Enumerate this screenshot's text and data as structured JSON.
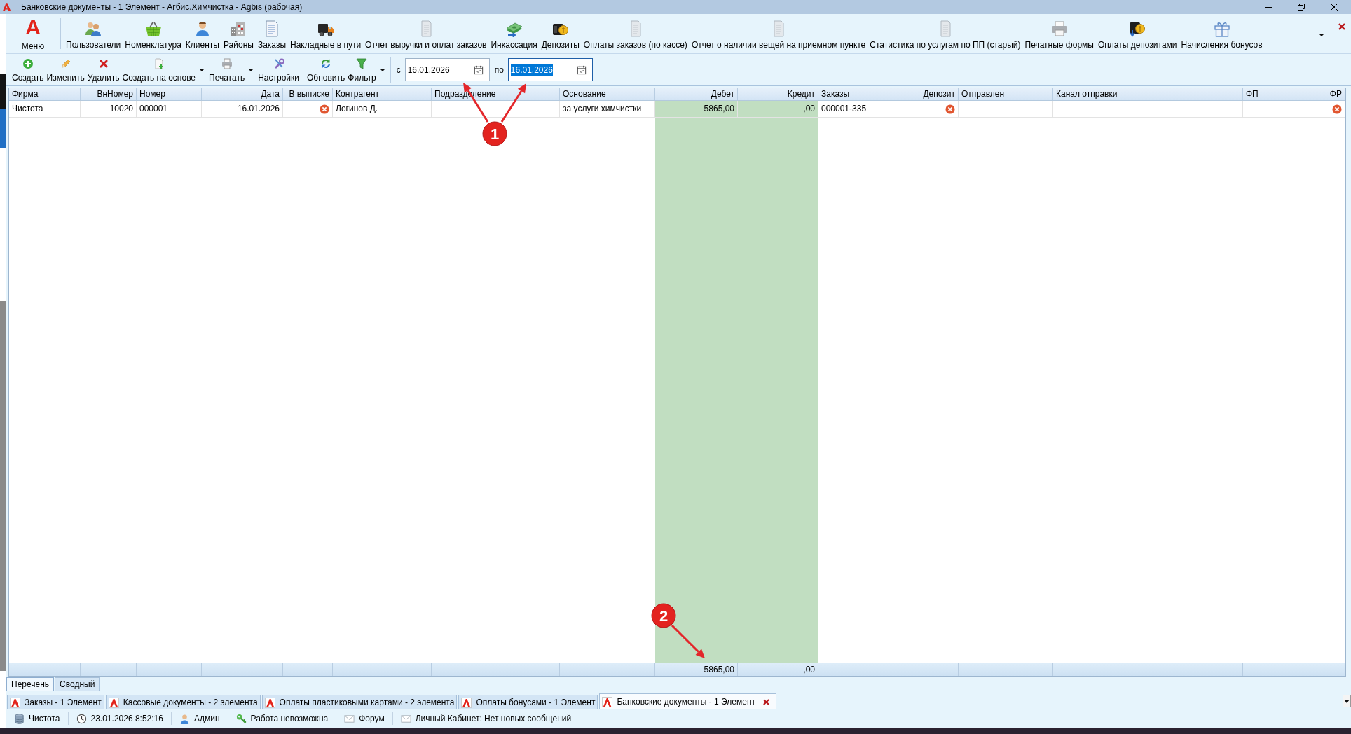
{
  "window": {
    "title": "Банковские документы - 1 Элемент - Агбис.Химчистка - Agbis (рабочая)"
  },
  "main_toolbar": {
    "menu": {
      "logo": "A",
      "label": "Меню"
    },
    "items": [
      "Пользователи",
      "Номенклатура",
      "Клиенты",
      "Районы",
      "Заказы",
      "Накладные в пути",
      "Отчет выручки и оплат заказов",
      "Инкассация",
      "Депозиты",
      "Оплаты заказов (по кассе)",
      "Отчет о наличии вещей на приемном пункте",
      "Статистика по услугам по ПП (старый)",
      "Печатные формы",
      "Оплаты депозитами",
      "Начисления бонусов"
    ]
  },
  "action_toolbar": {
    "groups": [
      {
        "buttons": [
          {
            "label": "Создать",
            "dropdown": false
          },
          {
            "label": "Изменить",
            "dropdown": false
          },
          {
            "label": "Удалить",
            "dropdown": false
          },
          {
            "label": "Создать на основе",
            "dropdown": true
          },
          {
            "label": "Печатать",
            "dropdown": true
          },
          {
            "label": "Настройки",
            "dropdown": false
          }
        ]
      },
      {
        "buttons": [
          {
            "label": "Обновить",
            "dropdown": false
          },
          {
            "label": "Фильтр",
            "dropdown": true
          }
        ]
      }
    ],
    "period": [
      {
        "label": "с",
        "value": "16.01.2026",
        "focused": false
      },
      {
        "label": "по",
        "value": "16.01.2026",
        "focused": true
      }
    ]
  },
  "table": {
    "columns": [
      {
        "title": "Фирма",
        "kind": "text",
        "highlighted": false,
        "cells": [
          "Чистота"
        ]
      },
      {
        "title": "ВнНомер",
        "kind": "number",
        "highlighted": false,
        "cells": [
          "10020"
        ]
      },
      {
        "title": "Номер",
        "kind": "text",
        "highlighted": false,
        "cells": [
          "000001"
        ]
      },
      {
        "title": "Дата",
        "kind": "date",
        "highlighted": false,
        "cells": [
          "16.01.2026"
        ]
      },
      {
        "title": "В выписке",
        "kind": "flag",
        "highlighted": false,
        "cells": [
          {
            "checked": false
          }
        ]
      },
      {
        "title": "Контрагент",
        "kind": "text",
        "highlighted": false,
        "cells": [
          "Логинов Д."
        ]
      },
      {
        "title": "Подразделение",
        "kind": "text",
        "highlighted": false
      },
      {
        "title": "Основание",
        "kind": "text",
        "highlighted": false,
        "cells": [
          "за услуги химчистки"
        ]
      },
      {
        "title": "Дебет",
        "kind": "number",
        "highlighted": true,
        "cells": [
          "5865,00"
        ],
        "total": "5865,00"
      },
      {
        "title": "Кредит",
        "kind": "number",
        "highlighted": true,
        "cells": [
          ",00"
        ],
        "total": ",00"
      },
      {
        "title": "Заказы",
        "kind": "text",
        "highlighted": false,
        "cells": [
          "000001-335"
        ]
      },
      {
        "title": "Депозит",
        "kind": "flag",
        "highlighted": false,
        "cells": [
          {
            "checked": false
          }
        ]
      },
      {
        "title": "Отправлен",
        "kind": "text",
        "highlighted": false
      },
      {
        "title": "Канал отправки",
        "kind": "text",
        "highlighted": false
      },
      {
        "title": "ФП",
        "kind": "text",
        "highlighted": false
      },
      {
        "title": "ФР",
        "kind": "flag",
        "highlighted": false,
        "cells": [
          {
            "checked": false
          }
        ]
      }
    ]
  },
  "view_tabs": [
    {
      "label": "Перечень",
      "selected": true
    },
    {
      "label": "Сводный",
      "selected": false
    }
  ],
  "document_tabs": [
    {
      "label": "Заказы - 1 Элемент",
      "selected": false
    },
    {
      "label": "Кассовые документы - 2 элемента",
      "selected": false
    },
    {
      "label": "Оплаты пластиковыми картами - 2 элемента",
      "selected": false
    },
    {
      "label": "Оплаты бонусами - 1 Элемент",
      "selected": false
    },
    {
      "label": "Банковские документы - 1 Элемент",
      "selected": true
    }
  ],
  "status_bar": [
    "Чистота",
    "23.01.2026 8:52:16",
    "Админ",
    "Работа невозможна",
    "Форум",
    "Личный Кабинет: Нет новых сообщений"
  ],
  "annotations": [
    {
      "label": "1"
    },
    {
      "label": "2"
    }
  ]
}
